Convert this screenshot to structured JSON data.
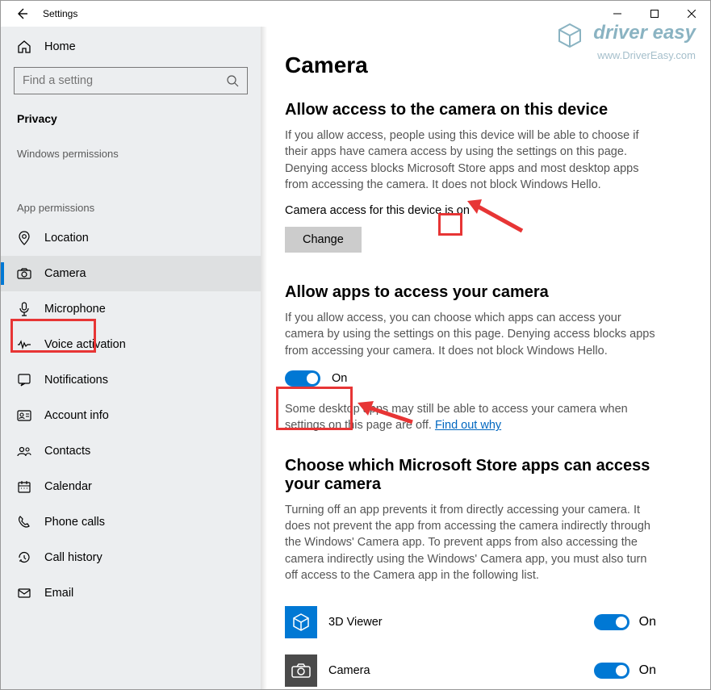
{
  "window": {
    "title": "Settings"
  },
  "sidebar": {
    "home": "Home",
    "search_placeholder": "Find a setting",
    "section": "Privacy",
    "group_windows": "Windows permissions",
    "group_app": "App permissions",
    "items": [
      {
        "label": "Location",
        "icon": "location-icon",
        "selected": false
      },
      {
        "label": "Camera",
        "icon": "camera-icon",
        "selected": true
      },
      {
        "label": "Microphone",
        "icon": "microphone-icon",
        "selected": false
      },
      {
        "label": "Voice activation",
        "icon": "voice-icon",
        "selected": false
      },
      {
        "label": "Notifications",
        "icon": "notifications-icon",
        "selected": false
      },
      {
        "label": "Account info",
        "icon": "account-icon",
        "selected": false
      },
      {
        "label": "Contacts",
        "icon": "contacts-icon",
        "selected": false
      },
      {
        "label": "Calendar",
        "icon": "calendar-icon",
        "selected": false
      },
      {
        "label": "Phone calls",
        "icon": "phone-icon",
        "selected": false
      },
      {
        "label": "Call history",
        "icon": "history-icon",
        "selected": false
      },
      {
        "label": "Email",
        "icon": "email-icon",
        "selected": false
      }
    ]
  },
  "main": {
    "title": "Camera",
    "device": {
      "heading": "Allow access to the camera on this device",
      "desc": "If you allow access, people using this device will be able to choose if their apps have camera access by using the settings on this page. Denying access blocks Microsoft Store apps and most desktop apps from accessing the camera. It does not block Windows Hello.",
      "status_prefix": "Camera access for this device is ",
      "status_value": "on",
      "change": "Change"
    },
    "apps": {
      "heading": "Allow apps to access your camera",
      "desc": "If you allow access, you can choose which apps can access your camera by using the settings on this page. Denying access blocks apps from accessing your camera. It does not block Windows Hello.",
      "toggle_state": "On",
      "note_prefix": "Some desktop apps may still be able to access your camera when settings on this page are off. ",
      "note_link": "Find out why"
    },
    "choose": {
      "heading": "Choose which Microsoft Store apps can access your camera",
      "desc": "Turning off an app prevents it from directly accessing your camera. It does not prevent the app from accessing the camera indirectly through the Windows' Camera app. To prevent apps from also accessing the camera indirectly using the Windows' Camera app, you must also turn off access to the Camera app in the following list.",
      "apps": [
        {
          "name": "3D Viewer",
          "state": "On",
          "icon": "cube-icon",
          "icon_bg": "#0078d4",
          "icon_fg": "#fff"
        },
        {
          "name": "Camera",
          "state": "On",
          "icon": "camera-icon",
          "icon_bg": "#4a4a4a",
          "icon_fg": "#fff"
        }
      ]
    }
  },
  "watermark": {
    "line1": "driver easy",
    "line2": "www.DriverEasy.com"
  }
}
